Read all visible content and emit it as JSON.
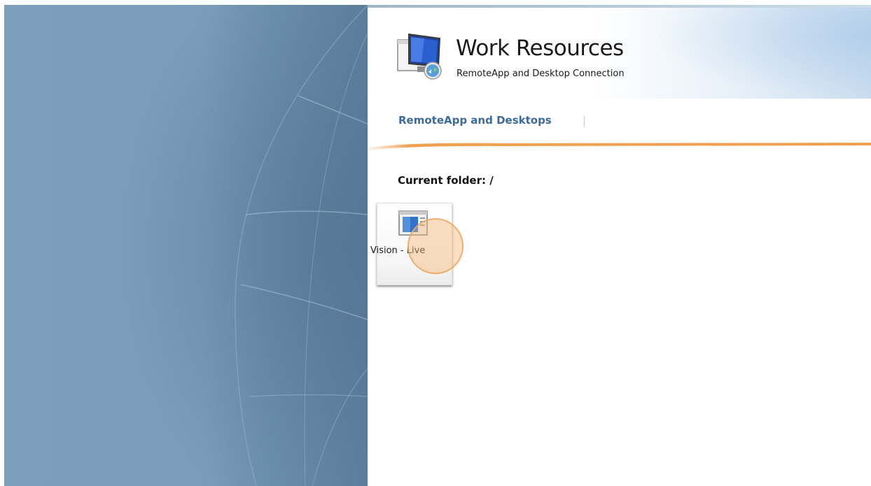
{
  "header": {
    "title": "Work Resources",
    "subtitle": "RemoteApp and Desktop Connection",
    "logo_icon": "remote-desktop-connection-icon"
  },
  "nav": {
    "tabs": [
      {
        "label": "RemoteApp and Desktops",
        "active": true
      }
    ]
  },
  "folder": {
    "label": "Current folder: /"
  },
  "apps": [
    {
      "label": "Vision - Live",
      "icon": "remote-desktop-app-icon"
    }
  ],
  "colors": {
    "nav_link": "#3c6a9c",
    "accent_orange": "#f0a050",
    "background_blue": "#7b9fbd"
  }
}
